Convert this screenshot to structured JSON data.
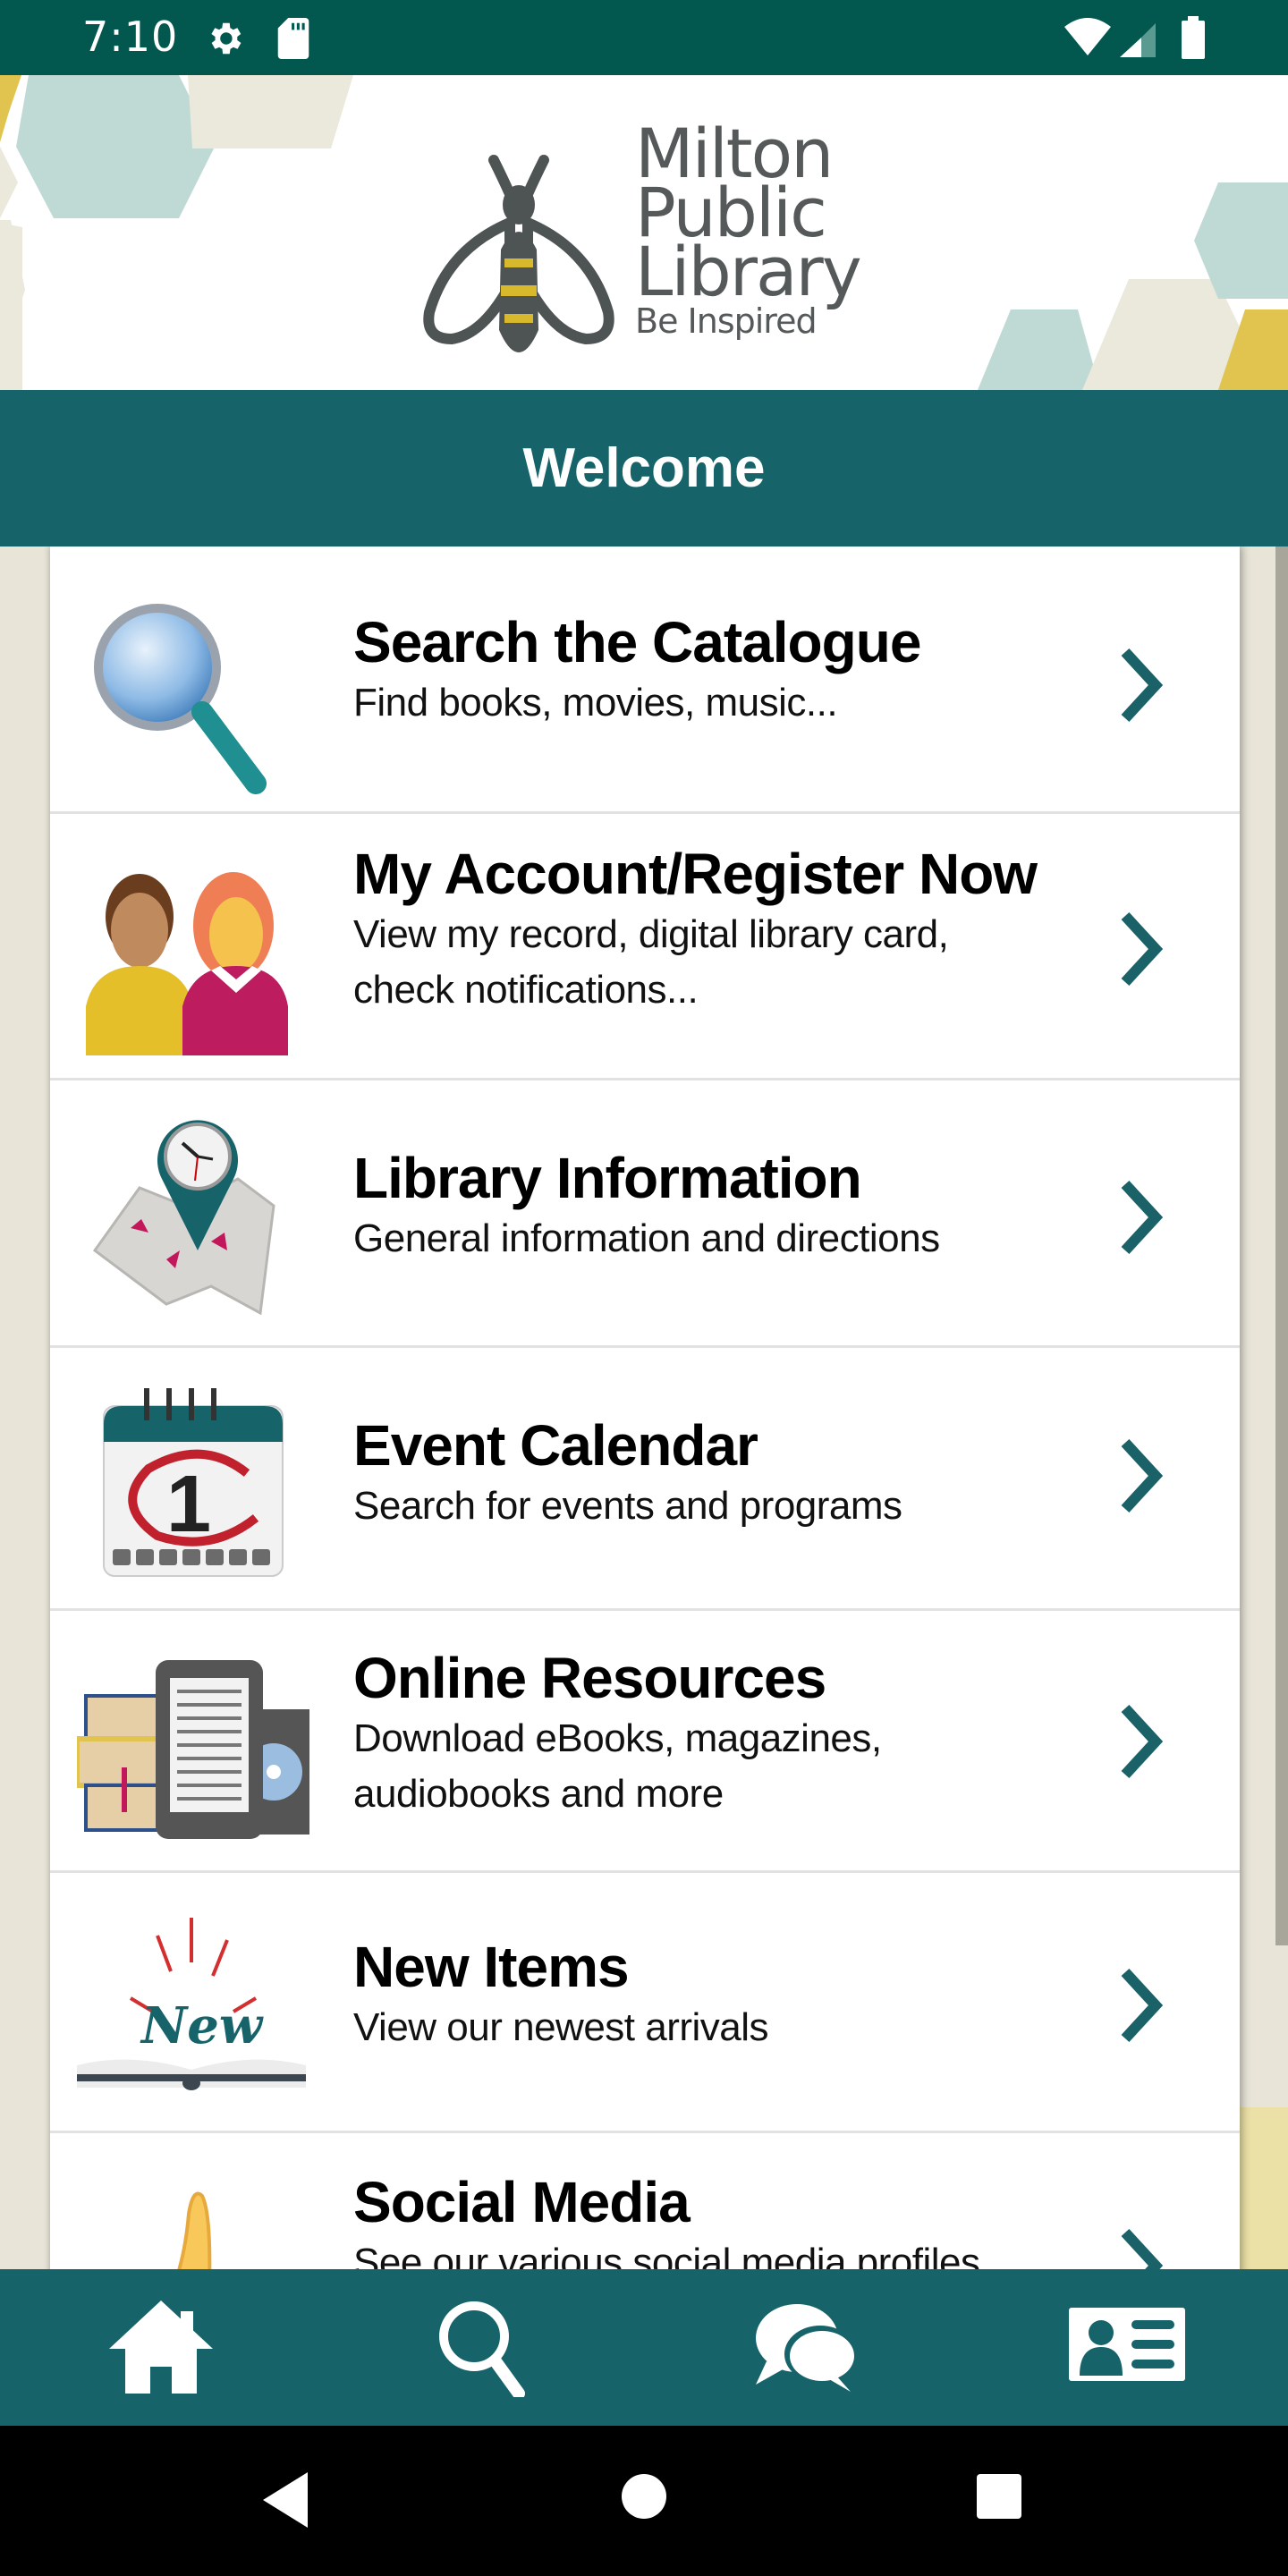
{
  "status_bar": {
    "time": "7:10",
    "left_icons": [
      "settings-gear-icon",
      "sd-card-icon"
    ],
    "right_icons": [
      "wifi-icon",
      "cellular-signal-icon",
      "battery-icon"
    ]
  },
  "header": {
    "logo_lines": [
      "Milton",
      "Public",
      "Library"
    ],
    "tagline": "Be Inspired",
    "logo_icon": "bee-icon"
  },
  "welcome": {
    "title": "Welcome"
  },
  "menu": {
    "items": [
      {
        "title": "Search the Catalogue",
        "subtitle": [
          "Find books, movies, music..."
        ],
        "icon": "magnifier-icon"
      },
      {
        "title": "My Account/Register Now",
        "subtitle": [
          "View my record, digital library card,",
          "check notifications..."
        ],
        "icon": "people-icon"
      },
      {
        "title": "Library Information",
        "subtitle": [
          "General information and directions"
        ],
        "icon": "map-clock-pin-icon"
      },
      {
        "title": "Event Calendar",
        "subtitle": [
          "Search for events and programs"
        ],
        "icon": "calendar-icon"
      },
      {
        "title": "Online Resources",
        "subtitle": [
          "Download eBooks, magazines,",
          "audiobooks and more"
        ],
        "icon": "ebook-reader-icon"
      },
      {
        "title": "New Items",
        "subtitle": [
          "View our newest arrivals"
        ],
        "icon": "new-book-icon"
      },
      {
        "title": "Social Media",
        "subtitle": [
          "See our various social media profiles"
        ],
        "icon": "thumbs-up-icon"
      }
    ]
  },
  "bottom_nav": {
    "items": [
      {
        "icon": "home-icon"
      },
      {
        "icon": "search-icon"
      },
      {
        "icon": "chat-icon"
      },
      {
        "icon": "library-card-icon"
      }
    ]
  },
  "colors": {
    "status_bar": "#02584f",
    "brand_teal": "#16636a",
    "accent_yellow": "#e1c34f",
    "hex_mint": "#bfdad4",
    "hex_cream": "#ebe8dc"
  }
}
